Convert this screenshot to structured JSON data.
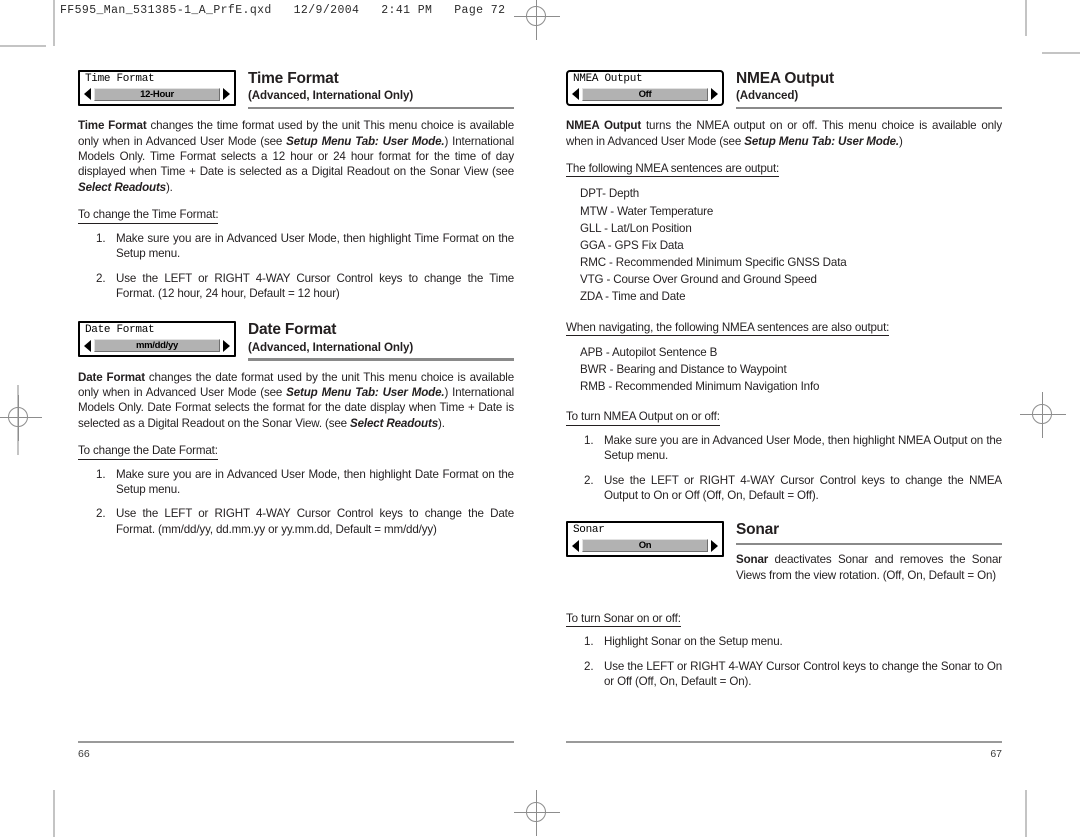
{
  "prepress": {
    "slug": "FF595_Man_531385-1_A_PrfE.qxd   12/9/2004   2:41 PM   Page 72"
  },
  "left_page": {
    "page_number": "66",
    "sections": [
      {
        "widget": {
          "label": "Time Format",
          "value": "12-Hour",
          "left_arrow": "left-arrow-icon",
          "right_arrow": "right-arrow-icon"
        },
        "title": "Time Format",
        "subtitle": "(Advanced, International Only)",
        "paragraph_html": "<b>Time Format</b> changes the time format used by the unit  This menu choice is available only when in Advanced User Mode (see <i class=\"bi\">Setup Menu Tab: User Mode.</i>) International Models Only. Time Format selects a 12 hour or 24 hour format for the time of day displayed when Time + Date is selected as a Digital Readout on the Sonar View (see <i class=\"bi\">Select Readouts</i>).",
        "steps_heading": "To change the Time Format:",
        "steps": [
          "Make sure you are in Advanced User Mode, then highlight Time Format on the Setup menu.",
          "Use the LEFT or RIGHT 4-WAY Cursor Control keys to change the Time Format. (12 hour, 24 hour, Default = 12 hour)"
        ]
      },
      {
        "widget": {
          "label": "Date Format",
          "value": "mm/dd/yy",
          "left_arrow": "left-arrow-icon",
          "right_arrow": "right-arrow-icon"
        },
        "title": "Date Format",
        "subtitle": "(Advanced, International Only)",
        "paragraph_html": "<b>Date Format</b> changes the date format used by the unit  This menu choice is available only when in Advanced User Mode (see <i class=\"bi\">Setup Menu Tab: User Mode.</i>)  International Models Only. Date Format selects the format for the date display when Time + Date is selected as a Digital Readout on the Sonar View. (see <i class=\"bi\">Select Readouts</i>).",
        "steps_heading": "To change the Date Format:",
        "steps": [
          "Make sure you are in Advanced User Mode, then highlight Date Format on the Setup menu.",
          "Use the LEFT or RIGHT 4-WAY Cursor Control keys to change the Date Format. (mm/dd/yy, dd.mm.yy or yy.mm.dd, Default = mm/dd/yy)"
        ]
      }
    ]
  },
  "right_page": {
    "page_number": "67",
    "nmea": {
      "widget": {
        "label": "NMEA Output",
        "value": "Off",
        "left_arrow": "left-arrow-icon",
        "right_arrow": "right-arrow-icon"
      },
      "title": "NMEA Output",
      "subtitle": "(Advanced)",
      "paragraph_html": "<b>NMEA Output</b> turns the NMEA output on or off.  This menu choice is available only when in Advanced User Mode (see <i class=\"bi\">Setup Menu Tab: User Mode.</i>)",
      "sentences_heading": "The following NMEA sentences are output:",
      "sentences": [
        "DPT- Depth",
        "MTW - Water Temperature",
        "GLL - Lat/Lon Position",
        "GGA - GPS Fix Data",
        "RMC - Recommended Minimum Specific GNSS Data",
        "VTG - Course Over Ground and Ground Speed",
        "ZDA - Time and Date"
      ],
      "nav_sentences_heading": "When navigating, the following NMEA sentences are also output:",
      "nav_sentences": [
        "APB - Autopilot Sentence B",
        "BWR - Bearing and Distance to Waypoint",
        "RMB - Recommended Minimum Navigation Info"
      ],
      "steps_heading": "To turn NMEA Output on or off:",
      "steps": [
        "Make sure you are in Advanced User Mode, then highlight NMEA Output on the Setup menu.",
        "Use the LEFT or RIGHT 4-WAY Cursor Control keys to change the NMEA Output to On or Off (Off, On, Default = Off)."
      ]
    },
    "sonar": {
      "widget": {
        "label": "Sonar",
        "value": "On",
        "left_arrow": "left-arrow-icon",
        "right_arrow": "right-arrow-icon"
      },
      "title": "Sonar",
      "subtitle": "",
      "paragraph_html": "<b>Sonar</b> deactivates Sonar and removes the Sonar Views from the view rotation. (Off, On, Default = On)",
      "steps_heading": "To turn Sonar on or off:",
      "steps": [
        "Highlight Sonar on the Setup menu.",
        "Use the LEFT or RIGHT 4-WAY Cursor Control keys to change the Sonar to On or Off (Off, On, Default = On)."
      ]
    }
  }
}
